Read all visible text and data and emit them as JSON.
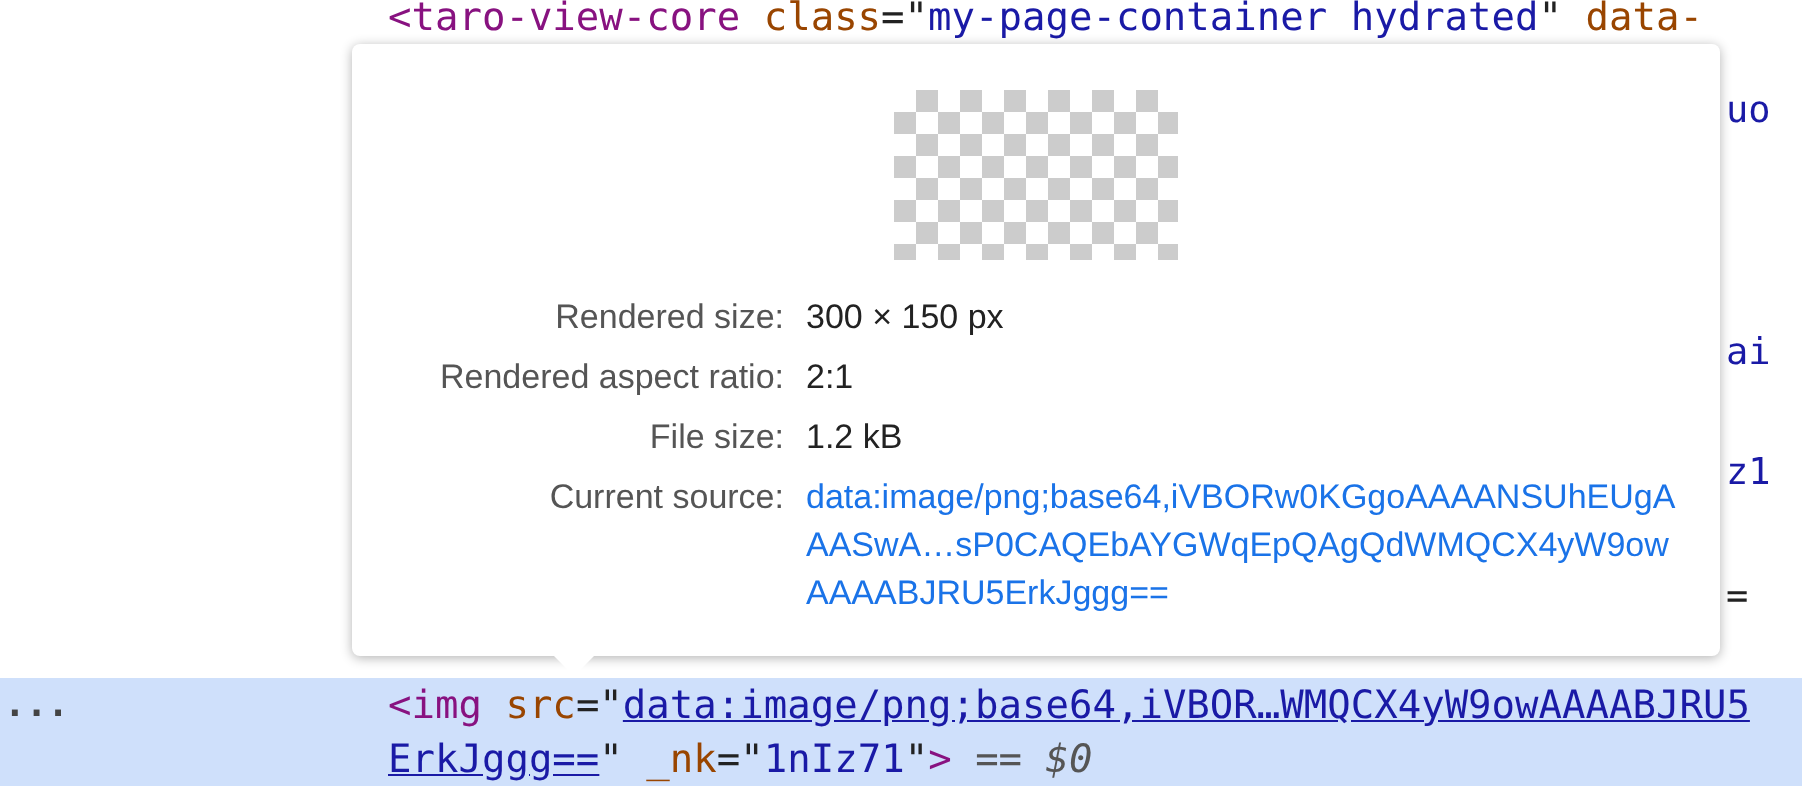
{
  "code_lines": [
    {
      "selected": false,
      "left": [
        {
          "kind": "tag",
          "text": "<taro-view-core "
        },
        {
          "kind": "attr",
          "text": "class"
        },
        {
          "kind": "plain",
          "text": "=\""
        },
        {
          "kind": "value",
          "text": "my-page-container hydrated"
        },
        {
          "kind": "plain",
          "text": "\" "
        },
        {
          "kind": "attr",
          "text": "data-"
        }
      ]
    },
    {
      "selected": false,
      "right": [
        {
          "kind": "value",
          "text": "uo"
        }
      ]
    },
    {
      "selected": false,
      "right": [
        {
          "kind": "value",
          "text": "ai"
        }
      ]
    },
    {
      "selected": false,
      "right": [
        {
          "kind": "value",
          "text": "z1"
        }
      ]
    },
    {
      "selected": false,
      "right": [
        {
          "kind": "plain",
          "text": "="
        }
      ]
    },
    {
      "selected": true,
      "gutter": "...",
      "left": [
        {
          "kind": "tag",
          "text": "<img "
        },
        {
          "kind": "attr",
          "text": "src"
        },
        {
          "kind": "plain",
          "text": "=\""
        },
        {
          "kind": "link",
          "text": "data:image/png;base64,iVBOR…WMQCX4yW9owAAAABJRU5"
        }
      ]
    },
    {
      "selected": true,
      "left": [
        {
          "kind": "link",
          "text": "ErkJggg=="
        },
        {
          "kind": "plain",
          "text": "\" "
        },
        {
          "kind": "attr",
          "text": "_nk"
        },
        {
          "kind": "plain",
          "text": "=\""
        },
        {
          "kind": "value",
          "text": "1nIz71"
        },
        {
          "kind": "plain",
          "text": "\""
        },
        {
          "kind": "tag",
          "text": ">"
        },
        {
          "kind": "note",
          "text": " == $0"
        }
      ]
    }
  ],
  "tooltip": {
    "rows": [
      {
        "label": "Rendered size:",
        "value": "300 × 150 px",
        "link": false
      },
      {
        "label": "Rendered aspect ratio:",
        "value": "2:1",
        "link": false
      },
      {
        "label": "File size:",
        "value": "1.2 kB",
        "link": false
      },
      {
        "label": "Current source:",
        "value": "data:image/png;base64,iVBORw0KGgoAAAANSUhEUgAAASwA…sP0CAQEbAYGWqEpQAgQdWMQCX4yW9owAAAABJRU5ErkJggg==",
        "link": true
      }
    ]
  }
}
